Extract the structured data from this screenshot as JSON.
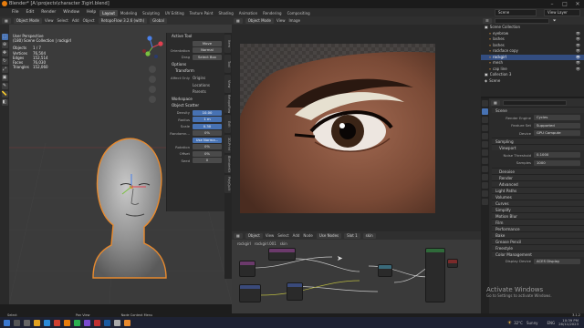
{
  "window": {
    "title": "Blender* [A:\\projects\\character 3\\girl.blend]",
    "minimize": "–",
    "maximize": "□",
    "close": "✕"
  },
  "menu": {
    "items": [
      "File",
      "Edit",
      "Render",
      "Window",
      "Help"
    ],
    "workspaces": [
      "Layout",
      "Modeling",
      "Sculpting",
      "UV Editing",
      "Texture Paint",
      "Shading",
      "Animation",
      "Rendering",
      "Compositing"
    ],
    "active_workspace": "Layout",
    "scene": "Scene",
    "view_layer": "View Layer"
  },
  "viewport": {
    "mode": "Object Mode",
    "view": "View",
    "select": "Select",
    "add": "Add",
    "object": "Object",
    "addon": "RetopoFlow 3.2.6 (with)",
    "orientation_label": "Orientation:",
    "orientation": "Default",
    "drag_label": "Drag:",
    "drag": "Select Box",
    "transform_space": "Global",
    "title": "User Perspective",
    "subtitle": "(180) Scene Collection | rockgirl",
    "stats": [
      {
        "k": "Objects",
        "v": "1 / 7"
      },
      {
        "k": "Vertices",
        "v": "76,504"
      },
      {
        "k": "Edges",
        "v": "152,514"
      },
      {
        "k": "Faces",
        "v": "76,030"
      },
      {
        "k": "Triangles",
        "v": "152,060"
      }
    ],
    "options": "Options"
  },
  "npanel": {
    "active_tool": "Active Tool",
    "tool_name": "Move",
    "orientation_label": "Orientation",
    "orientation": "Normal",
    "drag_label": "Drag",
    "drag": "Select Box",
    "options": "Options",
    "transform": "Transform",
    "affect_only": "Affect Only",
    "affect_items": [
      "Origins",
      "Locations",
      "Parents"
    ],
    "workspace": "Workspace",
    "scatter": "Object Scatter",
    "scatter_props": [
      {
        "l": "Density",
        "v": "10.00"
      },
      {
        "l": "Radius",
        "v": "1 m"
      },
      {
        "l": "Scale",
        "v": "0.30"
      },
      {
        "l": "Randomn...",
        "v": "0%"
      }
    ],
    "use_normal": "Use Norma...",
    "rot_props": [
      {
        "l": "Rotation",
        "v": "0%"
      },
      {
        "l": "Offset",
        "v": "0%"
      },
      {
        "l": "Seed",
        "v": "0"
      }
    ],
    "tabs": [
      "Item",
      "Tool",
      "View",
      "RetopoFlow",
      "Edit",
      "3D-Print",
      "BlenderKit",
      "PolyQuilt"
    ]
  },
  "image_editor": {
    "mode": "Object Mode",
    "view": "View",
    "object": "Image"
  },
  "node_editor": {
    "editor": "Object",
    "view": "View",
    "select": "Select",
    "add": "Add",
    "node": "Node",
    "use_nodes": "Use Nodes",
    "slot": "Slot 1",
    "material": "skin",
    "breadcrumb": "rockgirl",
    "breadcrumb2": "rockgirl.001",
    "breadcrumb3": "skin"
  },
  "outliner": {
    "title": "Scene Collection",
    "search_placeholder": "",
    "items": [
      {
        "name": "Scene Collection",
        "sel": false,
        "d": 0
      },
      {
        "name": "eyebrow",
        "sel": false,
        "d": 1
      },
      {
        "name": "lashes",
        "sel": false,
        "d": 1
      },
      {
        "name": "lashes",
        "sel": false,
        "d": 1
      },
      {
        "name": "rockface copy",
        "sel": false,
        "d": 1
      },
      {
        "name": "rockgirl",
        "sel": true,
        "d": 1
      },
      {
        "name": "mesh",
        "sel": false,
        "d": 1
      },
      {
        "name": "cap line",
        "sel": false,
        "d": 1
      },
      {
        "name": "Collection 3",
        "sel": false,
        "d": 0
      },
      {
        "name": "Scene",
        "sel": false,
        "d": 0
      }
    ]
  },
  "properties": {
    "header": "Scene",
    "render_engine_label": "Render Engine",
    "render_engine": "Cycles",
    "feature_set_label": "Feature Set",
    "feature_set": "Supported",
    "device_label": "Device",
    "device": "GPU Compute",
    "sampling": "Sampling",
    "viewport": "Viewport",
    "noise_label": "Noise Threshold",
    "noise": "0.1000",
    "samples_label": "Samples",
    "samples": "1000",
    "denoise": "Denoise",
    "render": "Render",
    "advanced": "Advanced",
    "sections": [
      "Light Paths",
      "Volumes",
      "Curves",
      "Simplify",
      "Motion Blur",
      "Film",
      "Performance",
      "Bake",
      "Grease Pencil",
      "Freestyle",
      "Color Management"
    ],
    "look_label": "Display Device",
    "look": "ACES Display"
  },
  "statusbar": {
    "left": "Select",
    "mid": "Pan View",
    "mid2": "Node Context Menu",
    "right": "3.1.2"
  },
  "watermark": {
    "title": "Activate Windows",
    "subtitle": "Go to Settings to activate Windows."
  },
  "taskbar": {
    "temp": "32°C",
    "weather": "Sunny",
    "lang": "ENG",
    "time": "10:39 PM",
    "date": "26/11/2023"
  },
  "colors": {
    "accent": "#4772b3",
    "selection": "#e88a2e",
    "skin": "#6b4b3b"
  }
}
